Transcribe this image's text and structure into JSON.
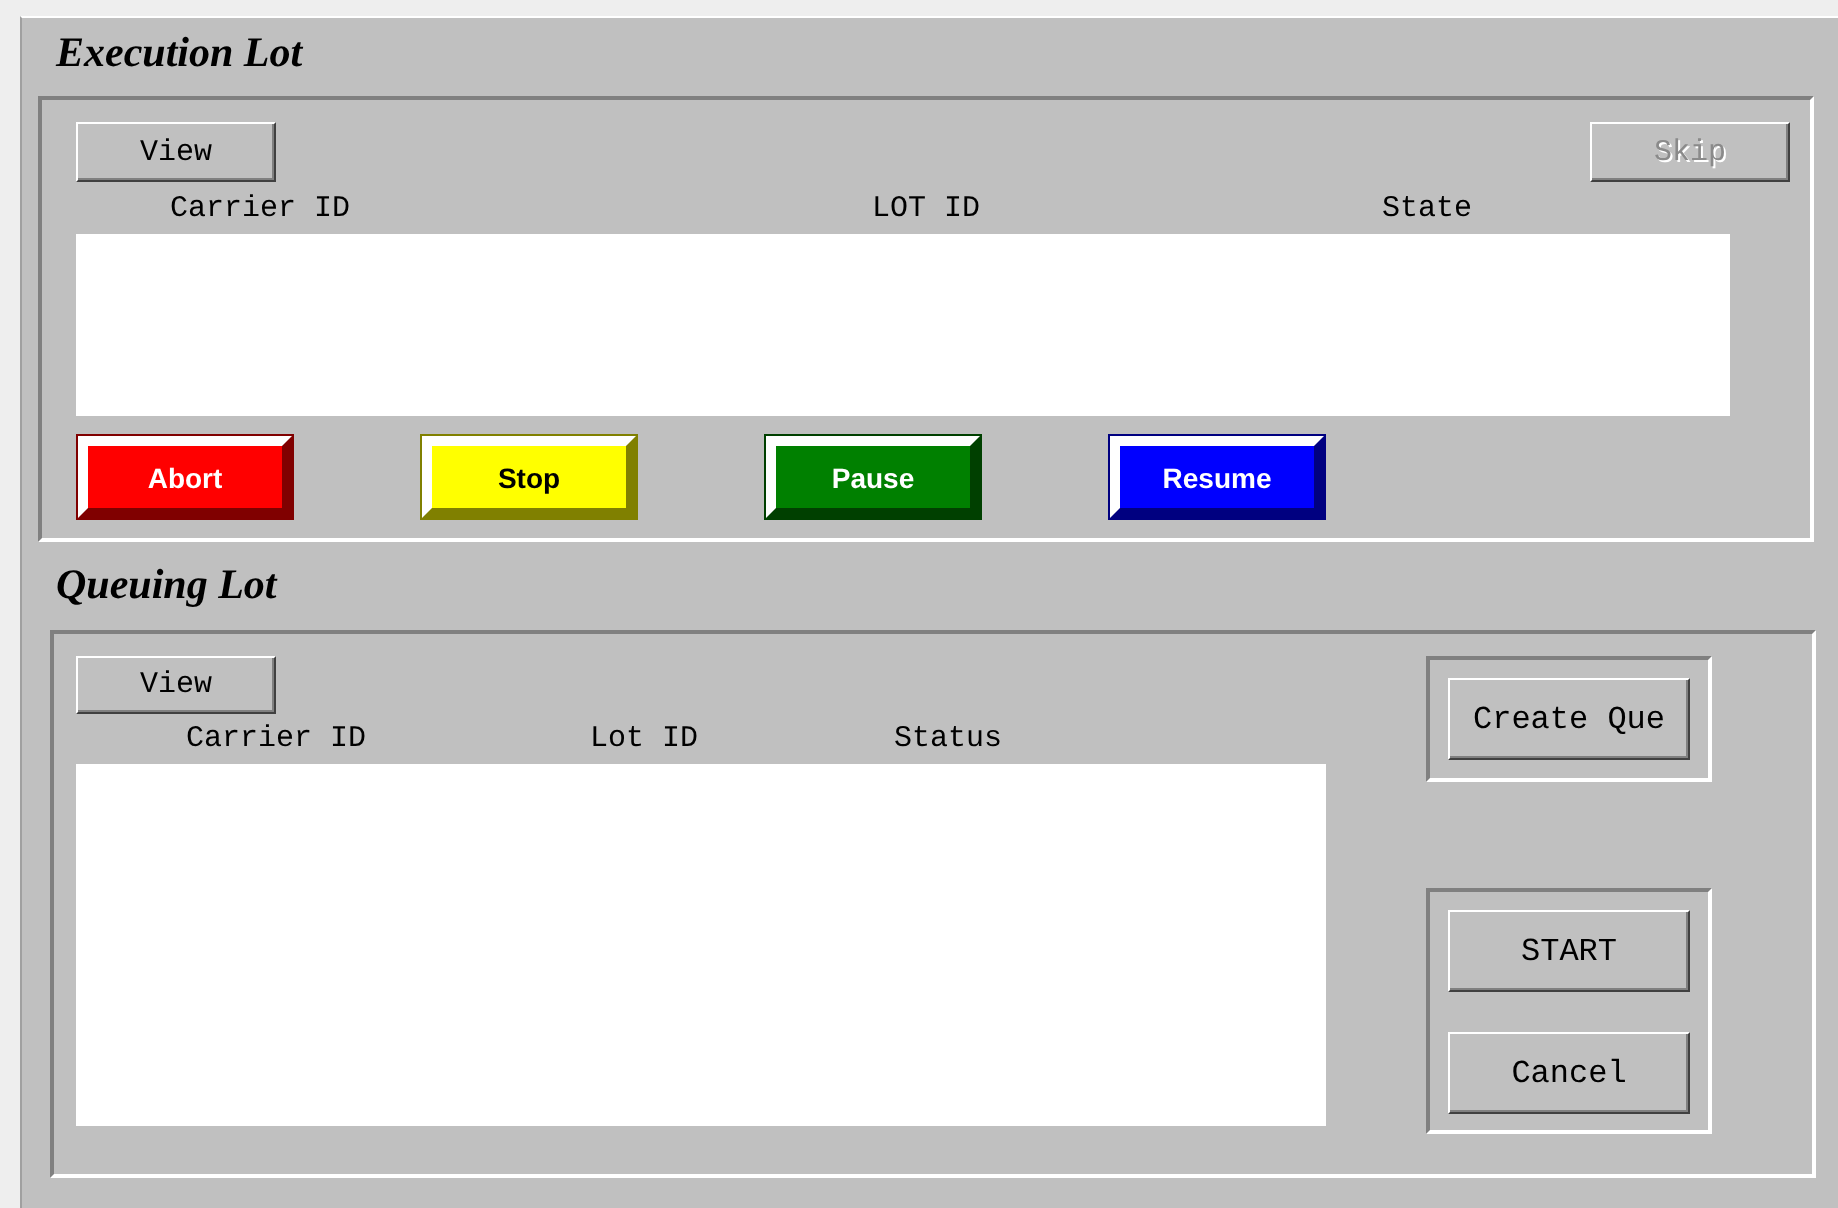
{
  "execution_lot": {
    "title": "Execution Lot",
    "view_button": {
      "label": "View",
      "disabled": false
    },
    "skip_button": {
      "label": "Skip",
      "disabled": true
    },
    "columns": [
      "Carrier ID",
      "LOT ID",
      "State"
    ],
    "action_buttons": [
      {
        "label": "Abort",
        "color": "#ff0000"
      },
      {
        "label": "Stop",
        "color": "#ffff00"
      },
      {
        "label": "Pause",
        "color": "#008000"
      },
      {
        "label": "Resume",
        "color": "#0000ff"
      }
    ]
  },
  "queuing_lot": {
    "title": "Queuing Lot",
    "view_button": {
      "label": "View",
      "disabled": false
    },
    "columns": [
      "Carrier ID",
      "Lot ID",
      "Status"
    ],
    "create_button": {
      "label": "Create Que",
      "disabled": false
    },
    "start_button": {
      "label": "START",
      "disabled": false
    },
    "cancel_button": {
      "label": "Cancel",
      "disabled": false
    }
  }
}
